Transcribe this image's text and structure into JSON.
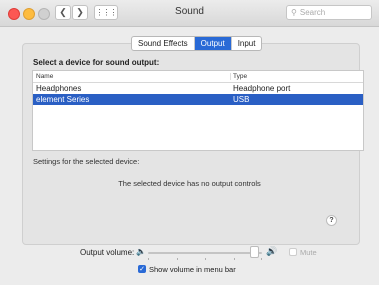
{
  "window": {
    "title": "Sound"
  },
  "toolbar": {
    "back_icon": "chevron-left-icon",
    "forward_icon": "chevron-right-icon",
    "show_all_icon": "grid-icon",
    "search_placeholder": "Search"
  },
  "tabs": [
    {
      "label": "Sound Effects",
      "active": false
    },
    {
      "label": "Output",
      "active": true
    },
    {
      "label": "Input",
      "active": false
    }
  ],
  "output": {
    "heading": "Select a device for sound output:",
    "columns": {
      "name": "Name",
      "type": "Type"
    },
    "devices": [
      {
        "name": "Headphones",
        "type": "Headphone port",
        "selected": false
      },
      {
        "name": "element Series",
        "type": "USB",
        "selected": true
      }
    ],
    "settings_label": "Settings for the selected device:",
    "no_controls_text": "The selected device has no output controls"
  },
  "help": {
    "label": "?"
  },
  "volume": {
    "label": "Output volume:",
    "level_fraction": 0.93,
    "mute_label": "Mute",
    "mute_checked": false,
    "show_in_menu_bar_label": "Show volume in menu bar",
    "show_in_menu_bar_checked": true
  },
  "colors": {
    "accent": "#2a6ad6",
    "selection": "#2a5fc4"
  }
}
